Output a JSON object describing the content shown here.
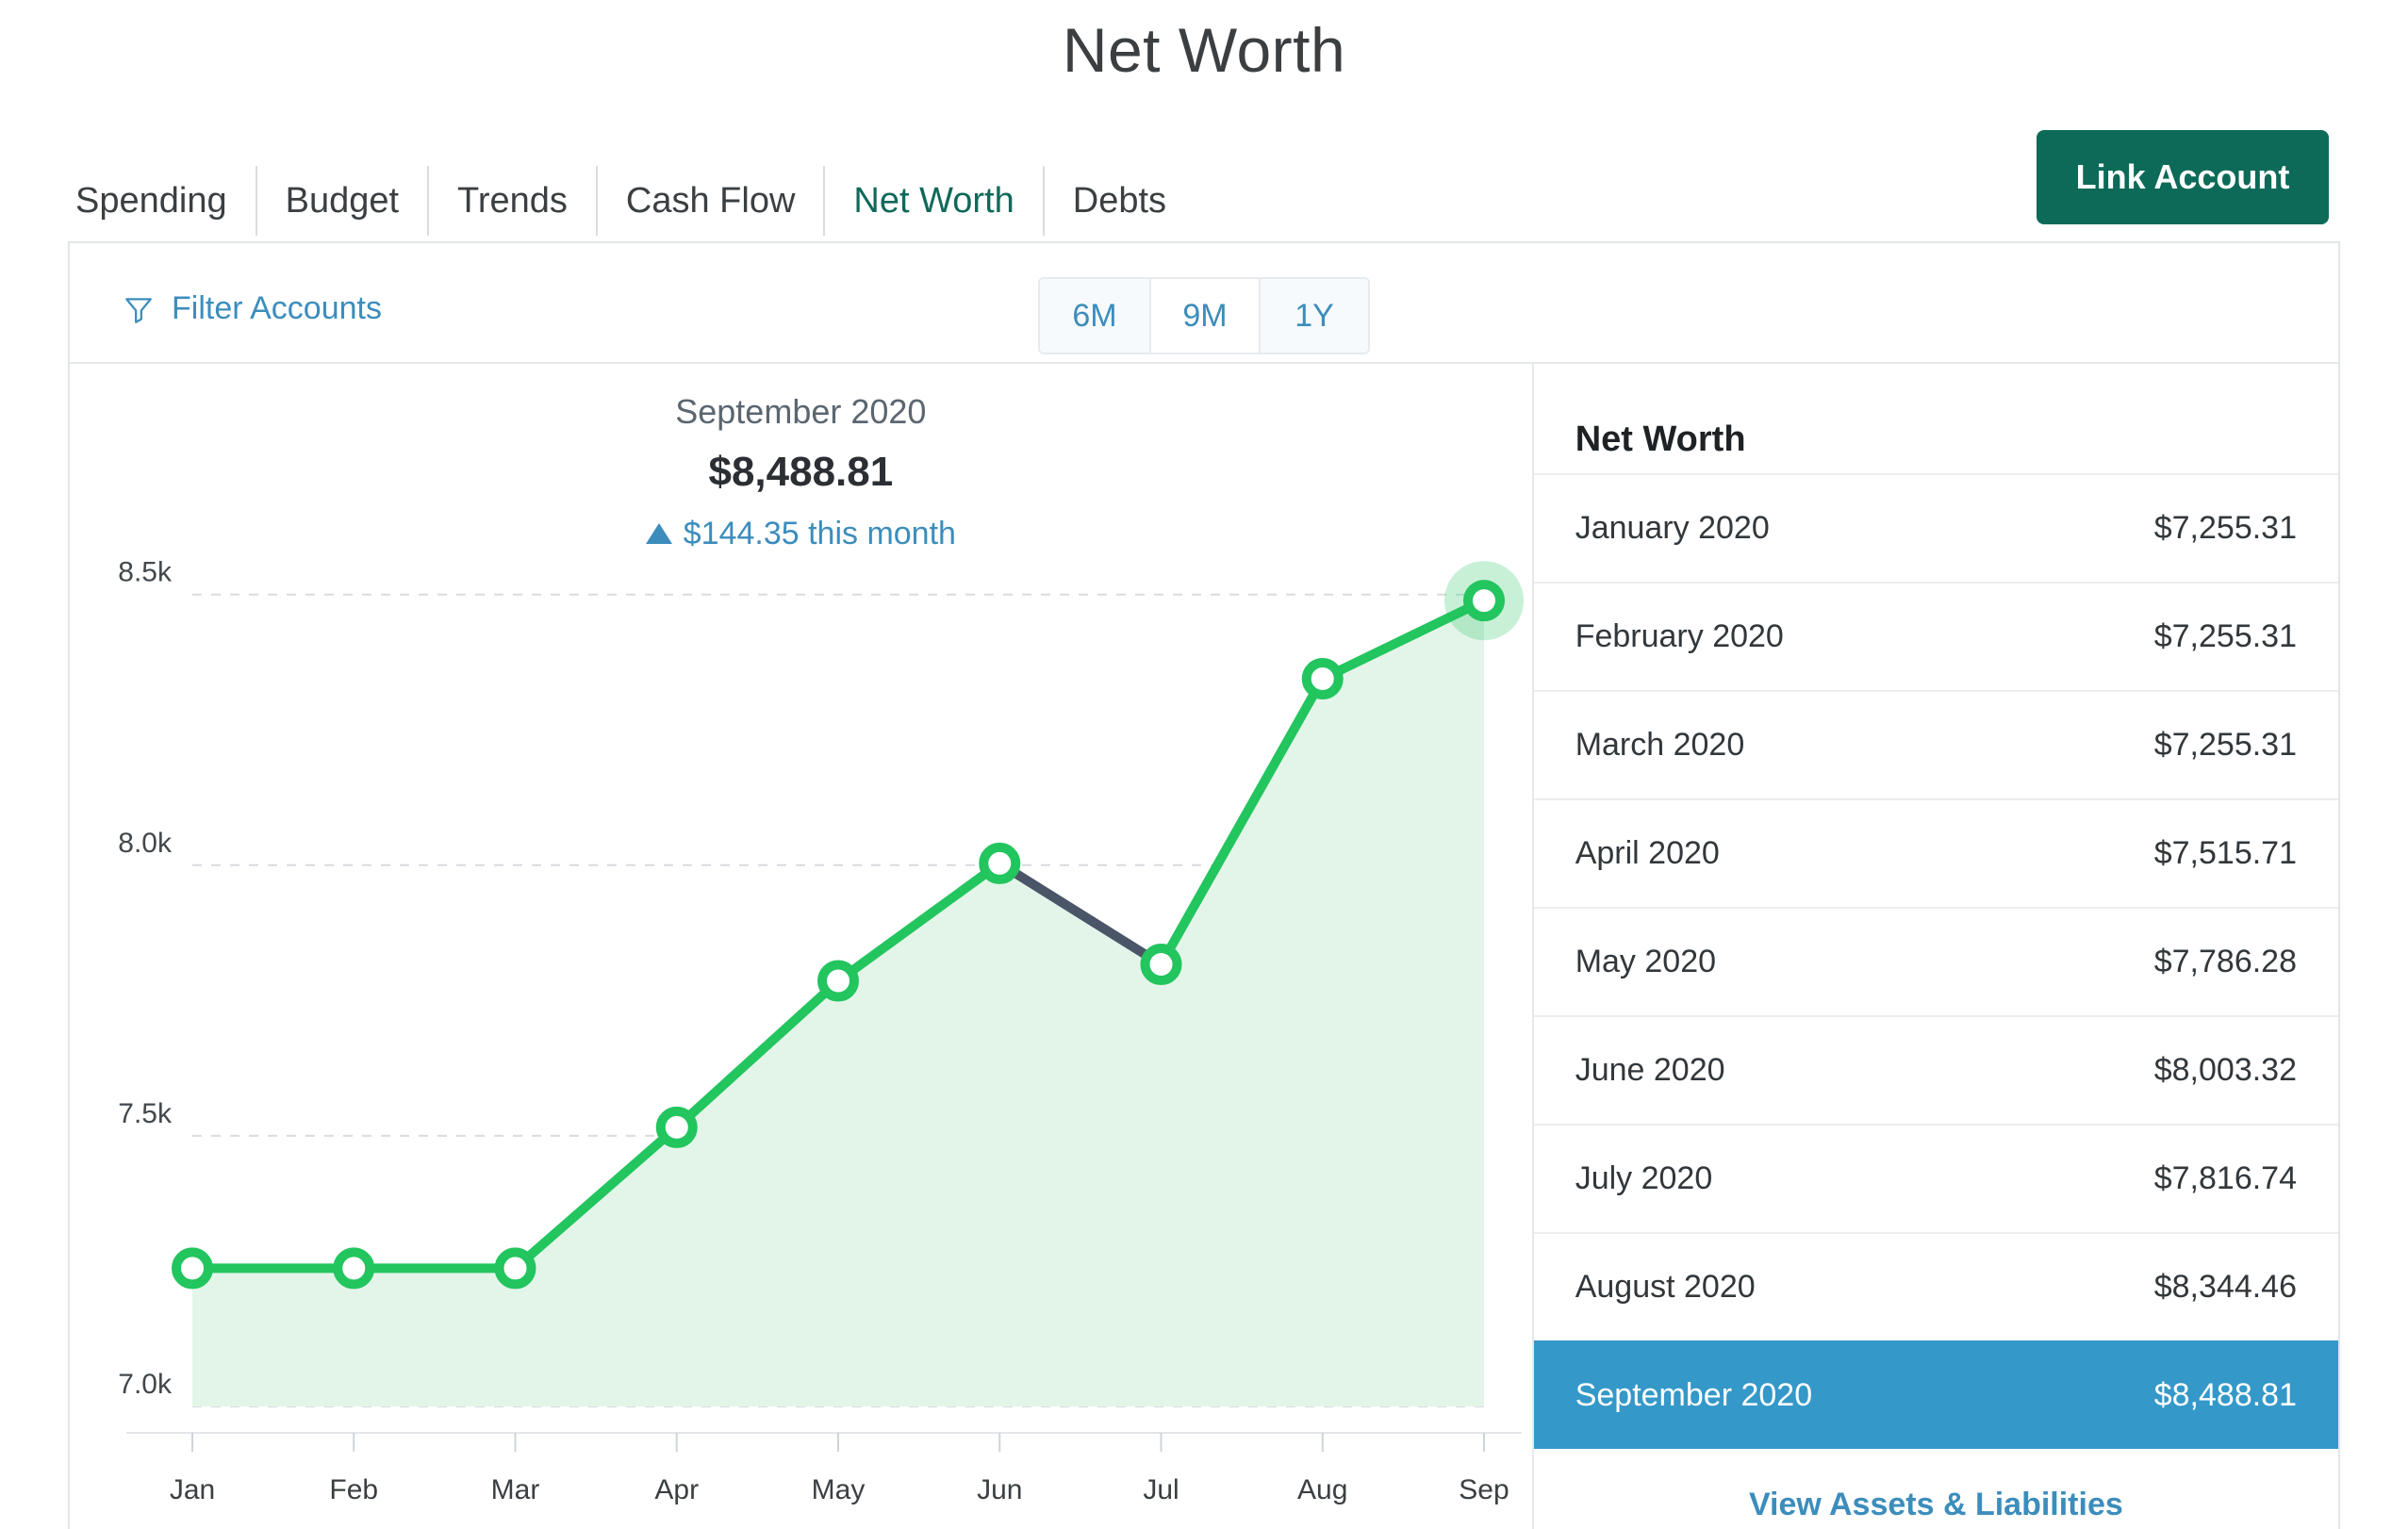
{
  "header": {
    "title": "Net Worth",
    "link_account_label": "Link Account"
  },
  "tabs": [
    {
      "label": "Spending",
      "active": false
    },
    {
      "label": "Budget",
      "active": false
    },
    {
      "label": "Trends",
      "active": false
    },
    {
      "label": "Cash Flow",
      "active": false
    },
    {
      "label": "Net Worth",
      "active": true
    },
    {
      "label": "Debts",
      "active": false
    }
  ],
  "toolbar": {
    "filter_label": "Filter Accounts",
    "filter_icon": "funnel-icon",
    "ranges": [
      {
        "label": "6M",
        "selected": false
      },
      {
        "label": "9M",
        "selected": true
      },
      {
        "label": "1Y",
        "selected": false
      }
    ]
  },
  "chart_header": {
    "month": "September 2020",
    "amount": "$8,488.81",
    "delta_icon": "triangle-up-icon",
    "delta": "$144.35 this month"
  },
  "sidebar": {
    "title": "Net Worth",
    "rows": [
      {
        "label": "January 2020",
        "value": "$7,255.31",
        "selected": false
      },
      {
        "label": "February 2020",
        "value": "$7,255.31",
        "selected": false
      },
      {
        "label": "March 2020",
        "value": "$7,255.31",
        "selected": false
      },
      {
        "label": "April 2020",
        "value": "$7,515.71",
        "selected": false
      },
      {
        "label": "May 2020",
        "value": "$7,786.28",
        "selected": false
      },
      {
        "label": "June 2020",
        "value": "$8,003.32",
        "selected": false
      },
      {
        "label": "July 2020",
        "value": "$7,816.74",
        "selected": false
      },
      {
        "label": "August 2020",
        "value": "$8,344.46",
        "selected": false
      },
      {
        "label": "September 2020",
        "value": "$8,488.81",
        "selected": true
      }
    ],
    "view_link": "View Assets & Liabilities"
  },
  "colors": {
    "brand_green": "#0d6a58",
    "line_up": "#22c55e",
    "line_down": "#4a5568",
    "area_fill": "#e3f5e9",
    "accent_blue": "#3c8dbc",
    "selected_row_blue": "#3498c9"
  },
  "chart_data": {
    "type": "line",
    "title": "",
    "xlabel": "",
    "ylabel": "",
    "categories": [
      "Jan",
      "Feb",
      "Mar",
      "Apr",
      "May",
      "Jun",
      "Jul",
      "Aug",
      "Sep"
    ],
    "values": [
      7255.31,
      7255.31,
      7255.31,
      7515.71,
      7786.28,
      8003.32,
      7816.74,
      8344.46,
      8488.81
    ],
    "series": [
      {
        "name": "Net Worth",
        "values": [
          7255.31,
          7255.31,
          7255.31,
          7515.71,
          7786.28,
          8003.32,
          7816.74,
          8344.46,
          8488.81
        ]
      }
    ],
    "ytick_labels": [
      "8.5k",
      "8.0k",
      "7.5k",
      "7.0k"
    ],
    "ytick_values": [
      8500,
      8000,
      7500,
      7000
    ],
    "ylim": [
      7000,
      8550
    ],
    "grid": "horizontal-dashed",
    "legend": "none",
    "highlighted_point": {
      "category": "Sep",
      "value": 8488.81
    },
    "segment_colors": [
      "up",
      "up",
      "up",
      "up",
      "up",
      "down",
      "up",
      "up"
    ]
  }
}
